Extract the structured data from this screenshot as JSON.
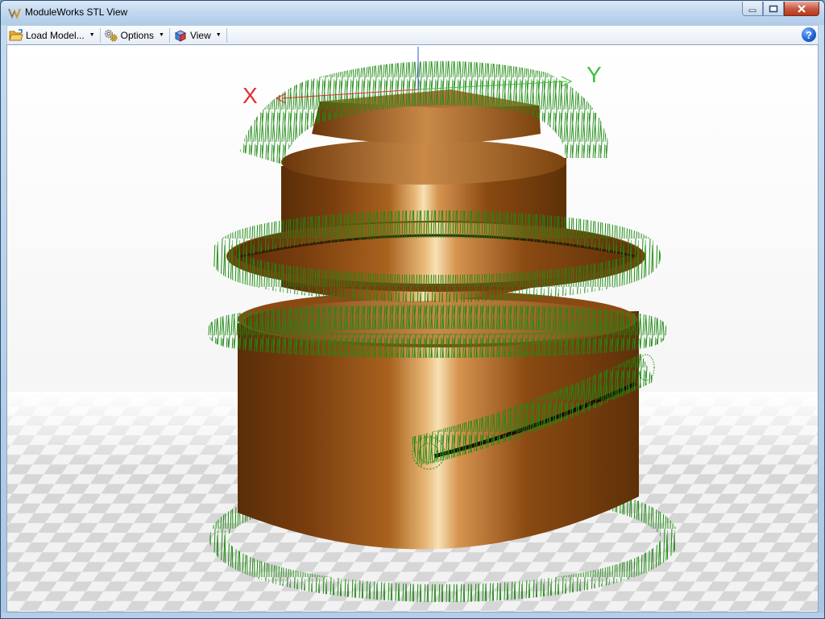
{
  "window": {
    "title": "ModuleWorks STL View",
    "app_icon": "moduleworks-logo-icon",
    "controls": {
      "minimize_icon": "minimize-icon",
      "maximize_icon": "maximize-icon",
      "close_icon": "close-icon"
    }
  },
  "toolbar": {
    "load_model_label": "Load Model...",
    "load_model_icon": "folder-open-icon",
    "options_label": "Options",
    "options_icon": "gears-icon",
    "view_label": "View",
    "view_icon": "cube-view-icon",
    "help_label": "?",
    "help_icon": "help-icon"
  },
  "viewport": {
    "axis_labels": {
      "x": "X",
      "y": "Y"
    },
    "colors": {
      "background_top": "#ffffff",
      "background_bottom": "#e6e6e6",
      "floor_dark": "#d4d4d4",
      "floor_light": "#f0f0f0",
      "model_dark": "#5a2e08",
      "model_mid": "#a85e1e",
      "model_highlight": "#f7e1b5",
      "normals": "#1e8a12",
      "x_axis": "#e03030",
      "y_axis": "#40c040",
      "z_axis": "#3050e0"
    }
  }
}
